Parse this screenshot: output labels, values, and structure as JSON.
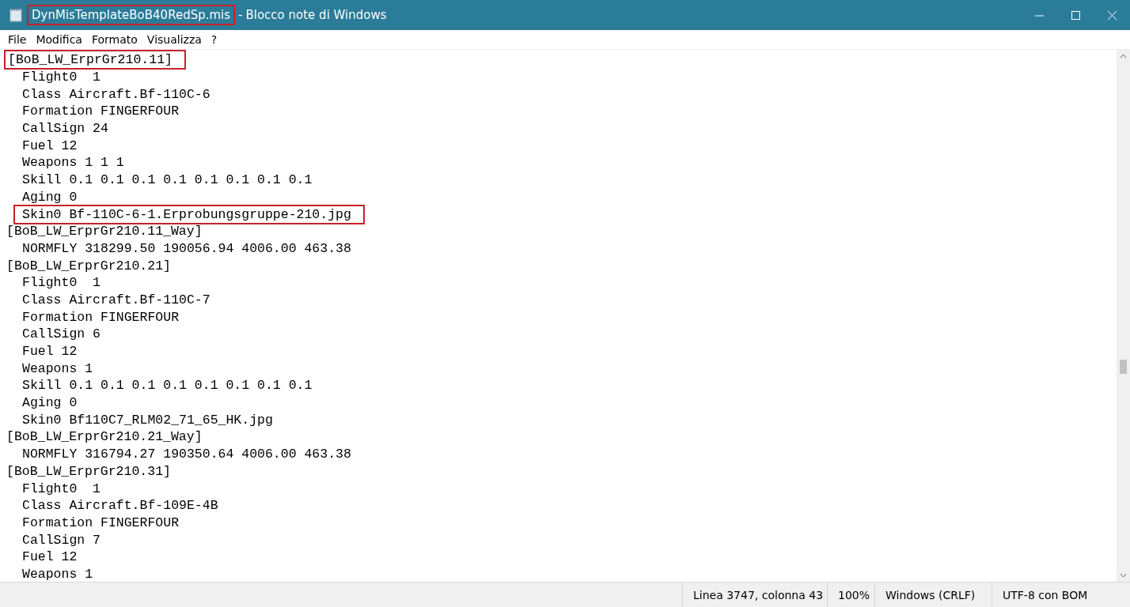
{
  "window": {
    "file_name": "DynMisTemplateBoB40RedSp.mis",
    "file_name_highlighted": true,
    "separator": "-",
    "app_name": "Blocco note di Windows"
  },
  "menu": [
    "File",
    "Modifica",
    "Formato",
    "Visualizza",
    "?"
  ],
  "lines": [
    {
      "text": "[BoB_LW_ErprGr210.11]",
      "kind": "section",
      "highlighted": true
    },
    {
      "text": "Flight0  1",
      "kind": "entry",
      "highlighted": false
    },
    {
      "text": "Class Aircraft.Bf-110C-6",
      "kind": "entry",
      "highlighted": false
    },
    {
      "text": "Formation FINGERFOUR",
      "kind": "entry",
      "highlighted": false
    },
    {
      "text": "CallSign 24",
      "kind": "entry",
      "highlighted": false
    },
    {
      "text": "Fuel 12",
      "kind": "entry",
      "highlighted": false
    },
    {
      "text": "Weapons 1 1 1",
      "kind": "entry",
      "highlighted": false
    },
    {
      "text": "Skill 0.1 0.1 0.1 0.1 0.1 0.1 0.1 0.1",
      "kind": "entry",
      "highlighted": false
    },
    {
      "text": "Aging 0",
      "kind": "entry",
      "highlighted": false
    },
    {
      "text": "Skin0 Bf-110C-6-1.Erprobungsgruppe-210.jpg",
      "kind": "entry",
      "highlighted": true
    },
    {
      "text": "[BoB_LW_ErprGr210.11_Way]",
      "kind": "section",
      "highlighted": false
    },
    {
      "text": "NORMFLY 318299.50 190056.94 4006.00 463.38",
      "kind": "entry",
      "highlighted": false
    },
    {
      "text": "[BoB_LW_ErprGr210.21]",
      "kind": "section",
      "highlighted": false
    },
    {
      "text": "Flight0  1",
      "kind": "entry",
      "highlighted": false
    },
    {
      "text": "Class Aircraft.Bf-110C-7",
      "kind": "entry",
      "highlighted": false
    },
    {
      "text": "Formation FINGERFOUR",
      "kind": "entry",
      "highlighted": false
    },
    {
      "text": "CallSign 6",
      "kind": "entry",
      "highlighted": false
    },
    {
      "text": "Fuel 12",
      "kind": "entry",
      "highlighted": false
    },
    {
      "text": "Weapons 1",
      "kind": "entry",
      "highlighted": false
    },
    {
      "text": "Skill 0.1 0.1 0.1 0.1 0.1 0.1 0.1 0.1",
      "kind": "entry",
      "highlighted": false
    },
    {
      "text": "Aging 0",
      "kind": "entry",
      "highlighted": false
    },
    {
      "text": "Skin0 Bf110C7_RLM02_71_65_HK.jpg",
      "kind": "entry",
      "highlighted": false
    },
    {
      "text": "[BoB_LW_ErprGr210.21_Way]",
      "kind": "section",
      "highlighted": false
    },
    {
      "text": "NORMFLY 316794.27 190350.64 4006.00 463.38",
      "kind": "entry",
      "highlighted": false
    },
    {
      "text": "[BoB_LW_ErprGr210.31]",
      "kind": "section",
      "highlighted": false
    },
    {
      "text": "Flight0  1",
      "kind": "entry",
      "highlighted": false
    },
    {
      "text": "Class Aircraft.Bf-109E-4B",
      "kind": "entry",
      "highlighted": false
    },
    {
      "text": "Formation FINGERFOUR",
      "kind": "entry",
      "highlighted": false
    },
    {
      "text": "CallSign 7",
      "kind": "entry",
      "highlighted": false
    },
    {
      "text": "Fuel 12",
      "kind": "entry",
      "highlighted": false
    },
    {
      "text": "Weapons 1",
      "kind": "entry",
      "highlighted": false
    }
  ],
  "status_bar": [
    "Linea 3747, colonna 43",
    "100%",
    "Windows (CRLF)",
    "UTF-8 con BOM"
  ]
}
